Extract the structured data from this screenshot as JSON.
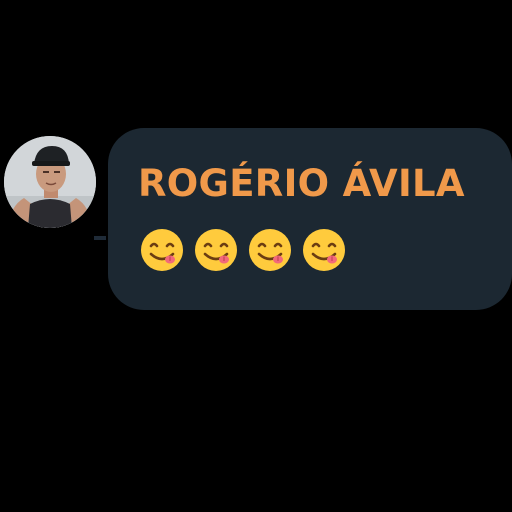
{
  "message": {
    "sender_name": "ROGÉRIO ÁVILA",
    "sender_color": "#f0994a",
    "bubble_color": "#1c2832",
    "emojis": [
      "face-savoring-food",
      "face-savoring-food",
      "face-savoring-food",
      "face-savoring-food"
    ]
  },
  "avatar": {
    "icon": "user-photo-avatar"
  }
}
